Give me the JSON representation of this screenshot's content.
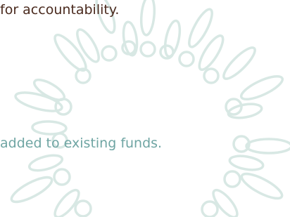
{
  "text": {
    "line_top": "for accountability.",
    "line_mid": "added to existing funds."
  },
  "colors": {
    "background": "#ffffff",
    "heading_text": "#4a2a1e",
    "accent_text": "#6fa5a3",
    "ornament_stroke": "#d8e8e4"
  },
  "ornament": {
    "name": "sunburst-petal-ring",
    "style": "outlined petals and circles"
  }
}
